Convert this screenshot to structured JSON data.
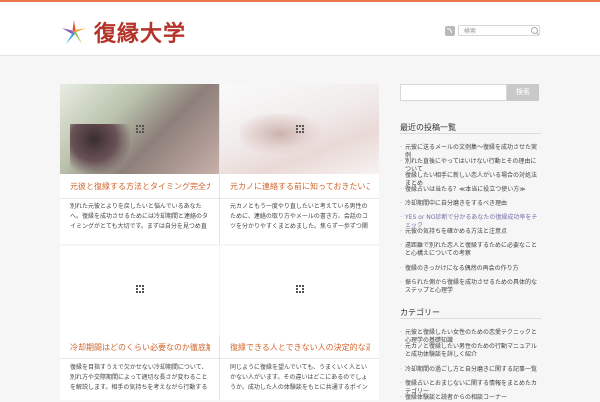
{
  "site": {
    "title": "復縁大学"
  },
  "header": {
    "search_placeholder": "検索",
    "rss_icon": "rss-icon",
    "search_icon": "search-icon"
  },
  "posts": [
    {
      "title": "元彼と復縁する方法とタイミング完全ガイド",
      "excerpt": "別れた元彼とよりを戻したいと悩んでいるあなたへ。復縁を成功させるためには冷却期間と連絡のタイミングがとても大切です。まずは自分を見つめ直すことから始めましょう。",
      "more": "..."
    },
    {
      "title": "元カノに連絡する前に知っておきたいこと",
      "excerpt": "元カノともう一度やり直したいと考えている男性のために、連絡の取り方やメールの書き方、会話のコツを分かりやすくまとめました。焦らず一歩ずつ関係を取り戻していきましょう。",
      "more": "..."
    },
    {
      "title": "冷却期間はどのくらい必要なのか徹底解説",
      "excerpt": "復縁を目指すうえで欠かせない冷却期間について、別れ方や交際期間によって適切な長さが変わることを解説します。相手の気持ちを考えながら行動することが大切です。",
      "more": "..."
    },
    {
      "title": "復縁できる人とできない人の決定的な違い",
      "excerpt": "同じように復縁を望んでいても、うまくいく人といかない人がいます。その違いはどこにあるのでしょうか。成功した人の体験談をもとに共通するポイントを紹介します。",
      "more": "..."
    }
  ],
  "sidebar": {
    "search_button": "検索",
    "recent_heading": "最近の投稿一覧",
    "recent": [
      "元彼に送るメールの文例集〜復縁を成功させた実例",
      "別れた直後にやってはいけない行動とその理由について",
      "復縁したい相手に新しい恋人がいる場合の対処法まとめ",
      "復縁占いは当たる？≪本当に役立つ使い方≫",
      "冷却期間中に自分磨きをするべき理由",
      "YES or NO診断で分かるあなたの復縁成功率をチェック",
      "元彼の気持ちを確かめる方法と注意点",
      "遠距離で別れた恋人と復縁するために必要なことと心構えについての考察",
      "復縁のきっかけになる偶然の再会の作り方",
      "振られた側から復縁を成功させるための具体的なステップと心理学"
    ],
    "category_heading": "カテゴリー",
    "categories": [
      "元彼と復縁したい女性のための恋愛テクニックと心理学の基礎知識",
      "元カノと復縁したい男性のための行動マニュアルと成功体験談を詳しく紹介",
      "冷却期間の過ごし方と自分磨きに関する記事一覧",
      "復縁占いとおまじないに関する情報をまとめたカテゴリー",
      "復縁体験談と読者からの相談コーナー"
    ]
  }
}
